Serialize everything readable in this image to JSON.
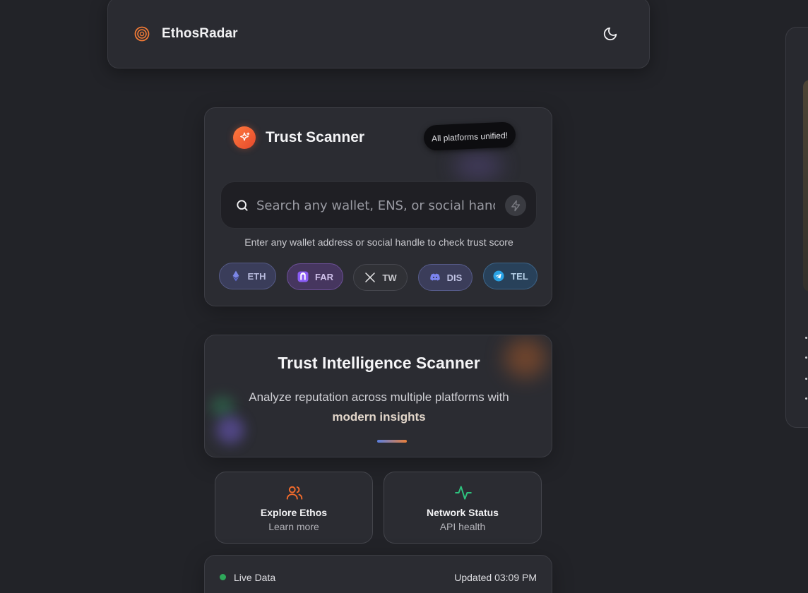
{
  "header": {
    "brand_name": "EthosRadar",
    "logo_icon": "radar-target-icon",
    "theme_icon": "moon-icon"
  },
  "scanner": {
    "title": "Trust Scanner",
    "badge": "All platforms unified!",
    "search_placeholder": "Search any wallet, ENS, or social handle",
    "search_value": "",
    "helper": "Enter any wallet address or social handle to check trust score",
    "platforms": [
      {
        "label": "ETH",
        "icon": "ethereum-icon",
        "color": "#7b86e6"
      },
      {
        "label": "FAR",
        "icon": "farcaster-icon",
        "color": "#8a5cf6"
      },
      {
        "label": "TW",
        "icon": "x-icon",
        "color": "#e8e8ea"
      },
      {
        "label": "DIS",
        "icon": "discord-icon",
        "color": "#7b84f0"
      },
      {
        "label": "TEL",
        "icon": "telegram-icon",
        "color": "#2aa3e6"
      }
    ]
  },
  "intel": {
    "title": "Trust Intelligence Scanner",
    "subtitle": "Analyze reputation across multiple platforms with",
    "subtitle_strong": "modern insights"
  },
  "actions": {
    "explore": {
      "title": "Explore Ethos",
      "sub": "Learn more",
      "icon": "users-icon"
    },
    "network": {
      "title": "Network Status",
      "sub": "API health",
      "icon": "activity-icon"
    }
  },
  "live": {
    "label": "Live Data",
    "updated": "Updated 03:09 PM"
  },
  "colors": {
    "background": "#222328",
    "card": "#2b2c32",
    "accent_orange": "#f26b2c",
    "accent_green": "#2ec27e"
  }
}
